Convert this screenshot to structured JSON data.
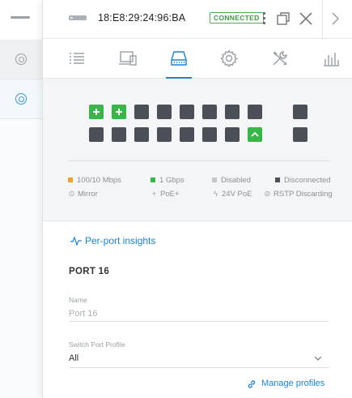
{
  "header": {
    "mac": "18:E8:29:24:96:BA",
    "status": "CONNECTED",
    "status_color": "#4caf50"
  },
  "tabs": [
    {
      "icon": "list-icon",
      "active": false
    },
    {
      "icon": "devices-icon",
      "active": false
    },
    {
      "icon": "ports-icon",
      "active": true
    },
    {
      "icon": "gear-icon",
      "active": false
    },
    {
      "icon": "tools-icon",
      "active": false
    },
    {
      "icon": "stats-icon",
      "active": false
    }
  ],
  "ports": {
    "top_row": [
      "uplink",
      "uplink",
      "disconnected",
      "disconnected",
      "disconnected",
      "disconnected",
      "disconnected",
      "disconnected",
      "disconnected"
    ],
    "bottom_row": [
      "disconnected",
      "disconnected",
      "disconnected",
      "disconnected",
      "disconnected",
      "disconnected",
      "disconnected",
      "uplink-selected",
      "disconnected"
    ],
    "colors": {
      "gigabit": "#39b54a",
      "fast": "#f0a028",
      "disabled": "#c4c7cc",
      "disconnected": "#4b4f58"
    }
  },
  "legend": {
    "speed_100": "100/10 Mbps",
    "speed_1g": "1 Gbps",
    "disabled": "Disabled",
    "disconnected": "Disconnected",
    "mirror": "Mirror",
    "poe_plus": "PoE+",
    "poe_24v": "24V PoE",
    "rstp": "RSTP Discarding"
  },
  "details": {
    "insights_link": "Per-port insights",
    "port_title": "PORT 16",
    "name_label": "Name",
    "name_placeholder": "Port 16",
    "profile_label": "Switch Port Profile",
    "profile_value": "All",
    "manage_link": "Manage profiles"
  }
}
